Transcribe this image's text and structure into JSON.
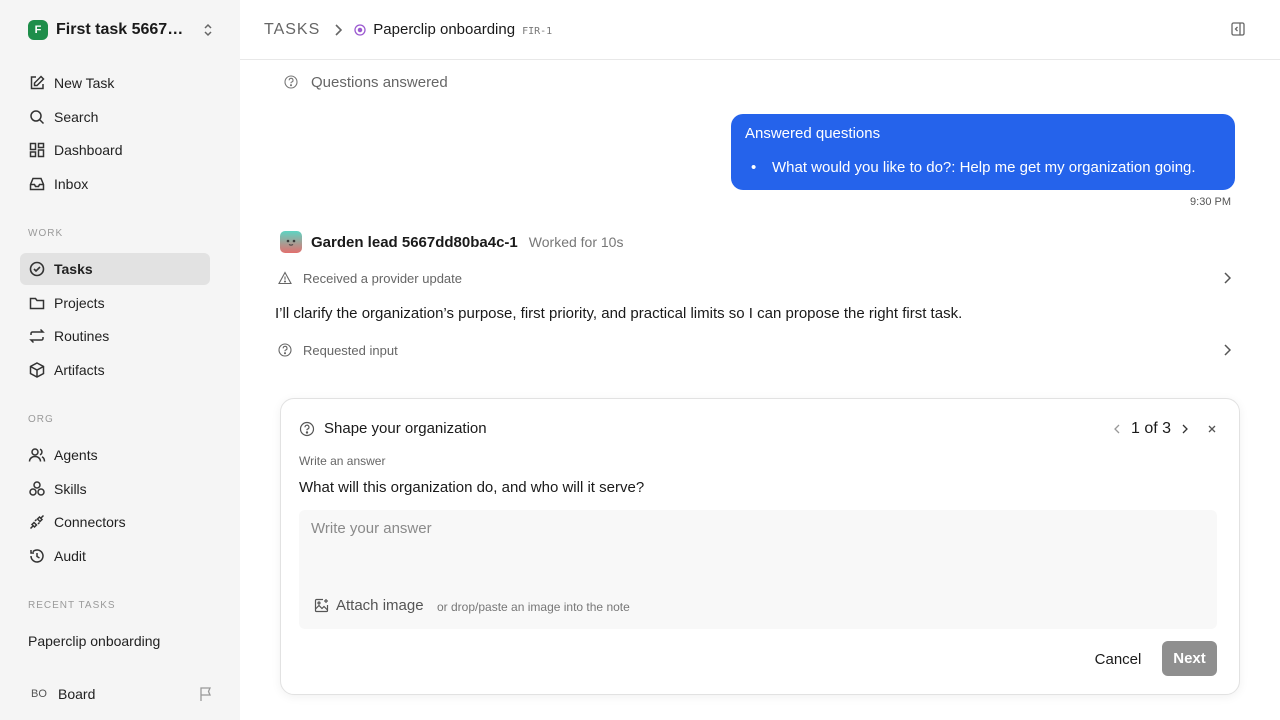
{
  "workspace": {
    "logo_letter": "F",
    "name": "First task 5667dd..."
  },
  "sidebar": {
    "primary": [
      {
        "label": "New Task",
        "icon": "edit-icon"
      },
      {
        "label": "Search",
        "icon": "search-icon"
      },
      {
        "label": "Dashboard",
        "icon": "dashboard-icon"
      },
      {
        "label": "Inbox",
        "icon": "inbox-icon"
      }
    ],
    "work_label": "WORK",
    "work": [
      {
        "label": "Tasks",
        "icon": "check-circle-icon",
        "active": true
      },
      {
        "label": "Projects",
        "icon": "folder-icon"
      },
      {
        "label": "Routines",
        "icon": "repeat-icon"
      },
      {
        "label": "Artifacts",
        "icon": "box-icon"
      }
    ],
    "org_label": "ORG",
    "org": [
      {
        "label": "Agents",
        "icon": "users-icon"
      },
      {
        "label": "Skills",
        "icon": "skills-icon"
      },
      {
        "label": "Connectors",
        "icon": "plug-icon"
      },
      {
        "label": "Audit",
        "icon": "history-icon"
      }
    ],
    "recent_label": "RECENT TASKS",
    "recent": [
      "Paperclip onboarding"
    ],
    "user": {
      "initials": "BO",
      "name": "Board"
    }
  },
  "header": {
    "root": "TASKS",
    "title": "Paperclip onboarding",
    "task_id": "FIR-1"
  },
  "feed": {
    "questions_answered": "Questions answered",
    "bubble": {
      "title": "Answered questions",
      "item": "What would you like to do?: Help me get my organization going.",
      "time": "9:30 PM"
    },
    "agent": {
      "name": "Garden lead 5667dd80ba4c-1",
      "meta": "Worked for 10s"
    },
    "provider_update": "Received a provider update",
    "message": "I’ll clarify the organization’s purpose, first priority, and practical limits so I can propose the right first task.",
    "requested_input": "Requested input"
  },
  "question_card": {
    "title": "Shape your organization",
    "pager": "1 of 3",
    "type": "Write an answer",
    "question": "What will this organization do, and who will it serve?",
    "placeholder": "Write your answer",
    "attach_label": "Attach image",
    "attach_hint": "or drop/paste an image into the note",
    "cancel_label": "Cancel",
    "next_label": "Next"
  },
  "colors": {
    "accent": "#2563eb",
    "status_purple": "#9b59d0",
    "next_disabled": "#8f8f8f"
  }
}
